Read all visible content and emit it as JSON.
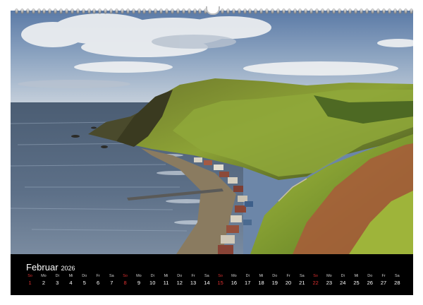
{
  "calendar": {
    "month": "Februar",
    "year": "2026",
    "days": [
      {
        "wd": "So",
        "n": "1",
        "sun": true
      },
      {
        "wd": "Mo",
        "n": "2"
      },
      {
        "wd": "Di",
        "n": "3"
      },
      {
        "wd": "Mi",
        "n": "4"
      },
      {
        "wd": "Do",
        "n": "5"
      },
      {
        "wd": "Fr",
        "n": "6"
      },
      {
        "wd": "Sa",
        "n": "7"
      },
      {
        "wd": "So",
        "n": "8",
        "sun": true
      },
      {
        "wd": "Mo",
        "n": "9"
      },
      {
        "wd": "Di",
        "n": "10"
      },
      {
        "wd": "Mi",
        "n": "11"
      },
      {
        "wd": "Do",
        "n": "12"
      },
      {
        "wd": "Fr",
        "n": "13"
      },
      {
        "wd": "Sa",
        "n": "14"
      },
      {
        "wd": "So",
        "n": "15",
        "sun": true
      },
      {
        "wd": "Mo",
        "n": "16"
      },
      {
        "wd": "Di",
        "n": "17"
      },
      {
        "wd": "Mi",
        "n": "18"
      },
      {
        "wd": "Do",
        "n": "19"
      },
      {
        "wd": "Fr",
        "n": "20"
      },
      {
        "wd": "Sa",
        "n": "21"
      },
      {
        "wd": "So",
        "n": "22",
        "sun": true
      },
      {
        "wd": "Mo",
        "n": "23"
      },
      {
        "wd": "Di",
        "n": "24"
      },
      {
        "wd": "Mi",
        "n": "25"
      },
      {
        "wd": "Do",
        "n": "26"
      },
      {
        "wd": "Fr",
        "n": "27"
      },
      {
        "wd": "Sa",
        "n": "28"
      }
    ]
  },
  "colors": {
    "bar_background": "#000000",
    "sunday": "#e03131",
    "day_text": "#ffffff"
  }
}
